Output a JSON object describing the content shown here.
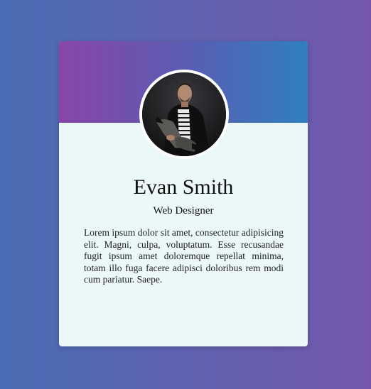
{
  "profile": {
    "name": "Evan Smith",
    "role": "Web Designer",
    "bio": "Lorem ipsum dolor sit amet, consectetur adipisicing elit. Magni, culpa, voluptatum. Esse recusandae fugit ipsum amet doloremque repellat minima, totam illo fuga facere adipisci doloribus rem modi cum pariatur. Saepe."
  },
  "colors": {
    "background_gradient": [
      "#4a6db5",
      "#7457ad"
    ],
    "header_gradient": [
      "#8a45aa",
      "#2f7fbf"
    ],
    "card_background": "#ebf8f8"
  }
}
